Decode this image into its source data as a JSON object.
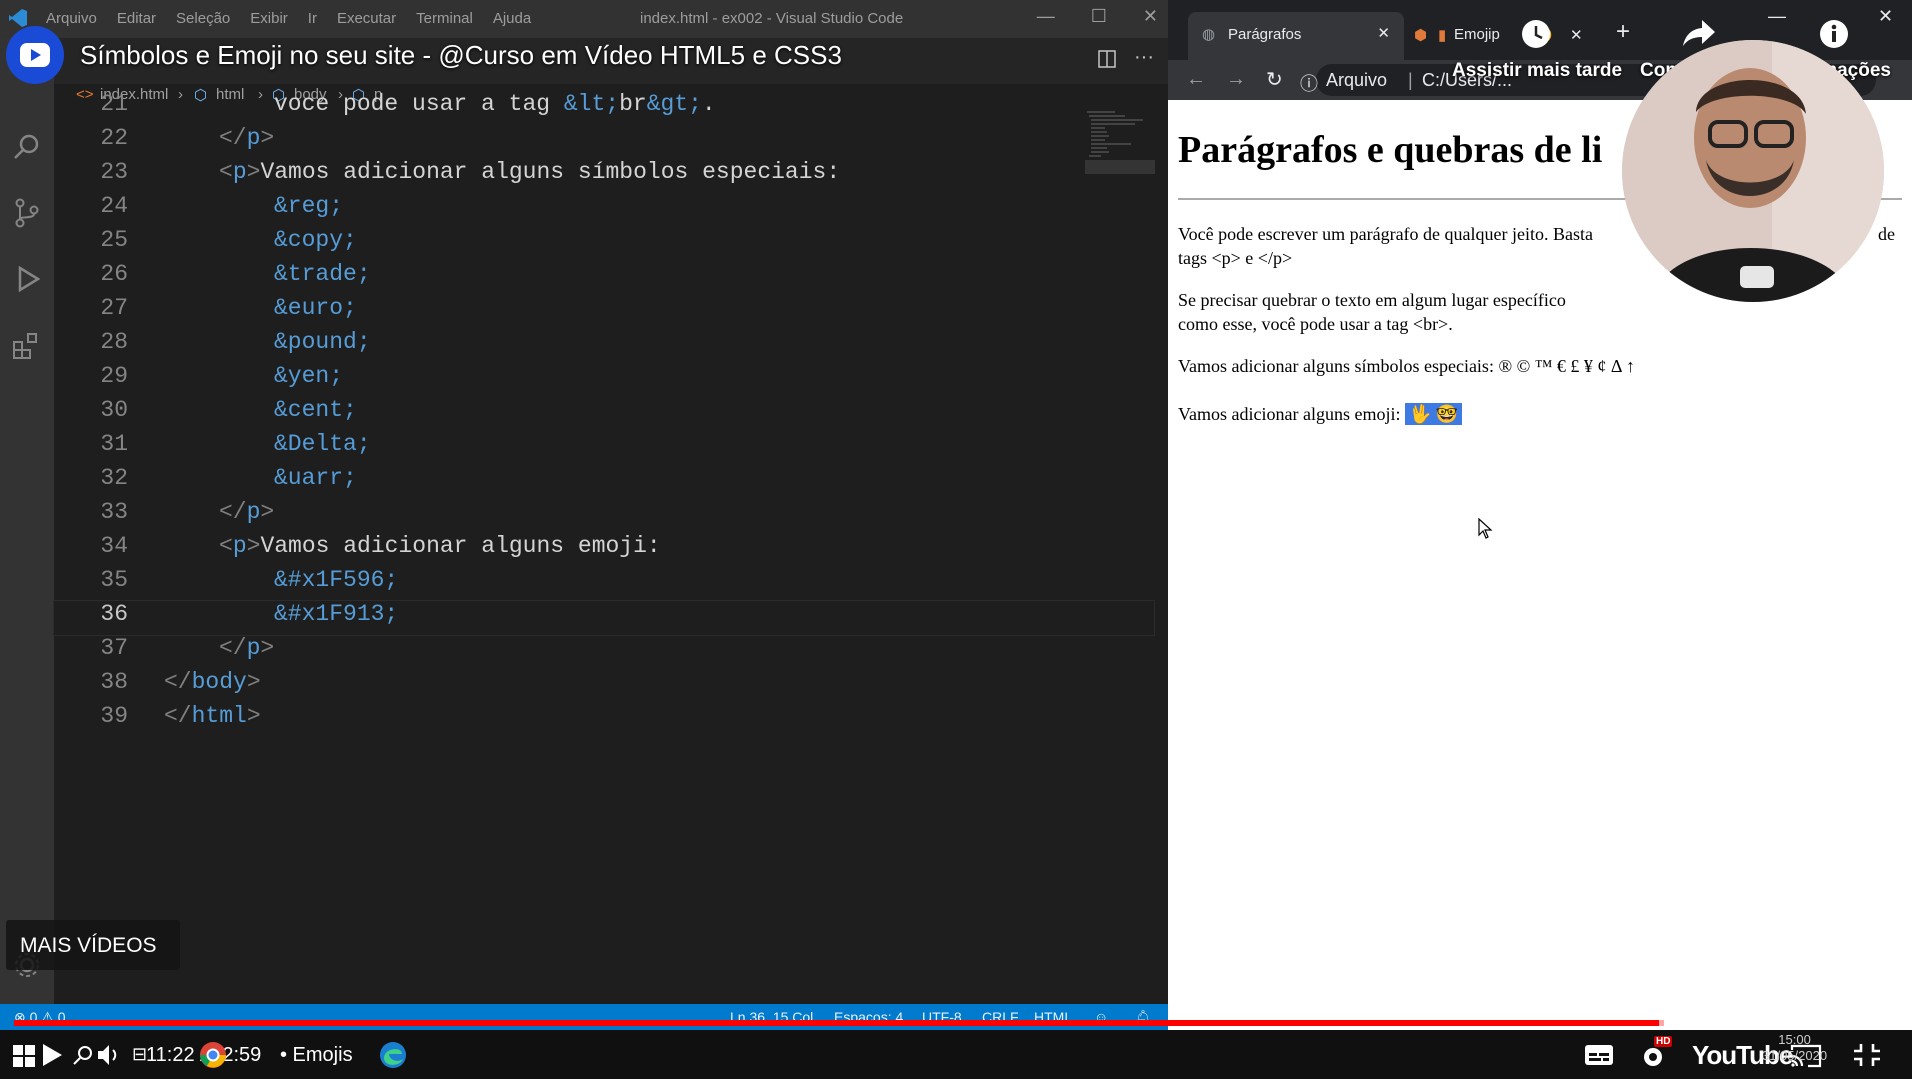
{
  "youtube": {
    "title": "Símbolos e Emoji no seu site - @Curso em Vídeo HTML5 e CSS3",
    "watch_later": "Assistir mais tarde",
    "share": "Compartilhar",
    "info": "Informações",
    "more_videos": "MAIS VÍDEOS",
    "time": "11:22 / 12:59",
    "chapter": "• Emojis",
    "brand": "YouTube",
    "hd_badge": "HD",
    "progress": 0.876
  },
  "vscode": {
    "menu": [
      "Arquivo",
      "Editar",
      "Seleção",
      "Exibir",
      "Ir",
      "Executar",
      "Terminal",
      "Ajuda"
    ],
    "window_title": "index.html - ex002 - Visual Studio Code",
    "breadcrumb": [
      "index.html",
      "html",
      "body",
      "p"
    ],
    "lines": [
      {
        "n": "21",
        "parts": [
          [
            "txt",
            "voce pode usar a tag "
          ],
          [
            "ent",
            "&lt;"
          ],
          [
            "txt",
            "br"
          ],
          [
            "ent",
            "&gt;"
          ],
          [
            "txt",
            "."
          ]
        ],
        "indent": 2
      },
      {
        "n": "22",
        "parts": [
          [
            "t",
            "</"
          ],
          [
            "tag",
            "p"
          ],
          [
            "t",
            ">"
          ]
        ],
        "indent": 1
      },
      {
        "n": "23",
        "parts": [
          [
            "t",
            "<"
          ],
          [
            "tag",
            "p"
          ],
          [
            "t",
            ">"
          ],
          [
            "txt",
            "Vamos adicionar alguns símbolos especiais:"
          ]
        ],
        "indent": 1
      },
      {
        "n": "24",
        "parts": [
          [
            "ent",
            "&reg;"
          ]
        ],
        "indent": 2
      },
      {
        "n": "25",
        "parts": [
          [
            "ent",
            "&copy;"
          ]
        ],
        "indent": 2
      },
      {
        "n": "26",
        "parts": [
          [
            "ent",
            "&trade;"
          ]
        ],
        "indent": 2
      },
      {
        "n": "27",
        "parts": [
          [
            "ent",
            "&euro;"
          ]
        ],
        "indent": 2
      },
      {
        "n": "28",
        "parts": [
          [
            "ent",
            "&pound;"
          ]
        ],
        "indent": 2
      },
      {
        "n": "29",
        "parts": [
          [
            "ent",
            "&yen;"
          ]
        ],
        "indent": 2
      },
      {
        "n": "30",
        "parts": [
          [
            "ent",
            "&cent;"
          ]
        ],
        "indent": 2
      },
      {
        "n": "31",
        "parts": [
          [
            "ent",
            "&Delta;"
          ]
        ],
        "indent": 2
      },
      {
        "n": "32",
        "parts": [
          [
            "ent",
            "&uarr;"
          ]
        ],
        "indent": 2
      },
      {
        "n": "33",
        "parts": [
          [
            "t",
            "</"
          ],
          [
            "tag",
            "p"
          ],
          [
            "t",
            ">"
          ]
        ],
        "indent": 1
      },
      {
        "n": "34",
        "parts": [
          [
            "t",
            "<"
          ],
          [
            "tag",
            "p"
          ],
          [
            "t",
            ">"
          ],
          [
            "txt",
            "Vamos adicionar alguns emoji:"
          ]
        ],
        "indent": 1
      },
      {
        "n": "35",
        "parts": [
          [
            "ent",
            "&#x1F596;"
          ]
        ],
        "indent": 2
      },
      {
        "n": "36",
        "parts": [
          [
            "ent",
            "&#x1F913;"
          ]
        ],
        "indent": 2
      },
      {
        "n": "37",
        "parts": [
          [
            "t",
            "</"
          ],
          [
            "tag",
            "p"
          ],
          [
            "t",
            ">"
          ]
        ],
        "indent": 1
      },
      {
        "n": "38",
        "parts": [
          [
            "t",
            "</"
          ],
          [
            "tag",
            "body"
          ],
          [
            "t",
            ">"
          ]
        ],
        "indent": 0
      },
      {
        "n": "39",
        "parts": [
          [
            "t",
            "</"
          ],
          [
            "tag",
            "html"
          ],
          [
            "t",
            ">"
          ]
        ],
        "indent": 0
      }
    ],
    "status": {
      "problems": "⊗ 0 ⚠ 0",
      "position": "Ln 36, 15 Col",
      "spaces": "Espaços: 4",
      "encoding": "UTF-8",
      "eol": "CRLF",
      "language": "HTML"
    },
    "colors": {
      "keyword": "#569cd6",
      "statusbar": "#007acc"
    }
  },
  "browser": {
    "tab1_title": "Parágrafos",
    "tab2_title": "Emojip",
    "address_label": "Arquivo",
    "address_value": "C:/Users/...",
    "page": {
      "heading": "Parágrafos e quebras de li",
      "p1": "Você pode escrever um parágrafo de qualquer jeito. Basta",
      "p1_tail": "de",
      "p1_line2": "tags <p> e </p>",
      "p2_line1": "Se precisar quebrar o texto em algum lugar específico",
      "p2_line2": "como esse, você pode usar a tag <br>.",
      "p3": "Vamos adicionar alguns símbolos especiais: ® © ™ € £ ¥ ¢ Δ ↑",
      "p4": "Vamos adicionar alguns emoji:",
      "emoji": "🖖 🤓"
    }
  },
  "taskbar": {
    "clock_time": "15:00",
    "clock_date": "31/05/2020"
  }
}
